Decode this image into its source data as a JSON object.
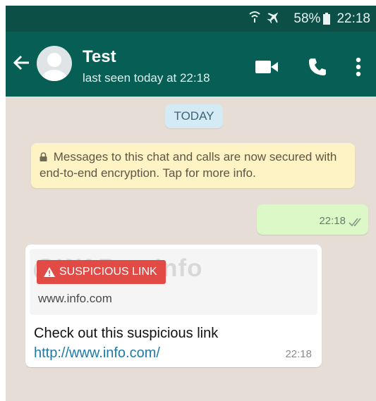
{
  "status_bar": {
    "battery": "58%",
    "time": "22:18"
  },
  "header": {
    "contact_name": "Test",
    "last_seen": "last seen today at 22:18"
  },
  "chat": {
    "date_label": "TODAY",
    "encryption_notice": "Messages to this chat and calls are now secured with end-to-end encryption. Tap for more info.",
    "outgoing_message": {
      "time": "22:18"
    },
    "incoming_message": {
      "watermark": "@WABetaInfo",
      "warning_label": "SUSPICIOUS LINK",
      "preview_domain": "www.info.com",
      "text": "Check out this suspicious link ",
      "link": "http://www.info.com/",
      "time": "22:18"
    }
  },
  "colors": {
    "header": "#075e54",
    "status_bar": "#0b4f47",
    "chat_background": "#e6ded6",
    "outgoing_bubble": "#dcf8c6",
    "warning": "#e24a45",
    "link": "#1f7aa8"
  }
}
